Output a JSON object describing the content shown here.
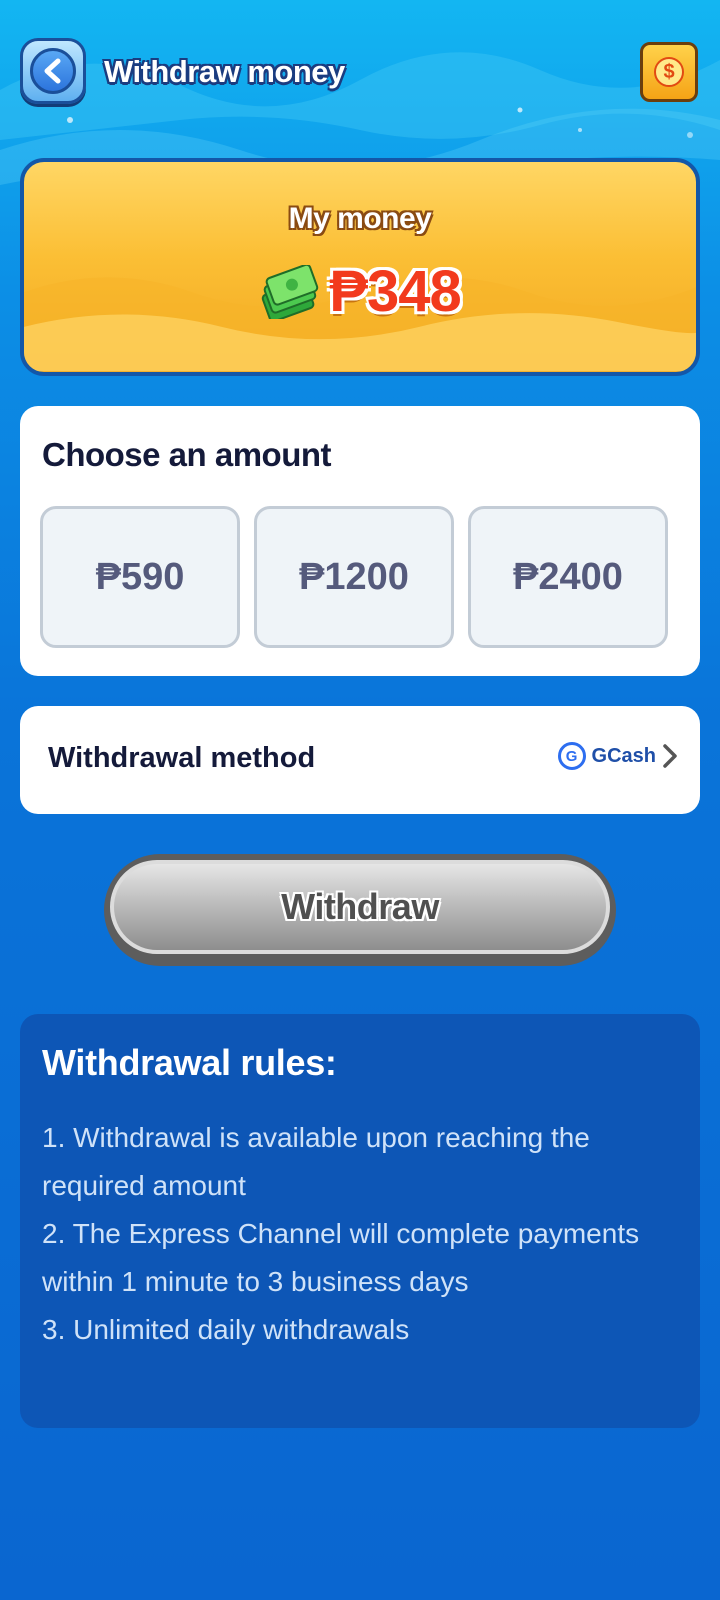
{
  "header": {
    "title": "Withdraw money"
  },
  "balance": {
    "label": "My money",
    "amount": "₱348"
  },
  "amounts": {
    "title": "Choose an amount",
    "options": [
      "₱590",
      "₱1200",
      "₱2400"
    ]
  },
  "method": {
    "label": "Withdrawal method",
    "value": "GCash"
  },
  "withdraw_button": {
    "label": "Withdraw"
  },
  "rules": {
    "title": "Withdrawal rules:",
    "items": [
      "1. Withdrawal is available upon reaching the required amount",
      "2. The Express Channel will complete payments within 1 minute to 3 business days",
      "3. Unlimited daily withdrawals"
    ]
  },
  "colors": {
    "background": "#0a74d9",
    "money_card": "#fbbf35",
    "amount_text": "#f23a1d",
    "rules_card": "#0d56b6"
  }
}
